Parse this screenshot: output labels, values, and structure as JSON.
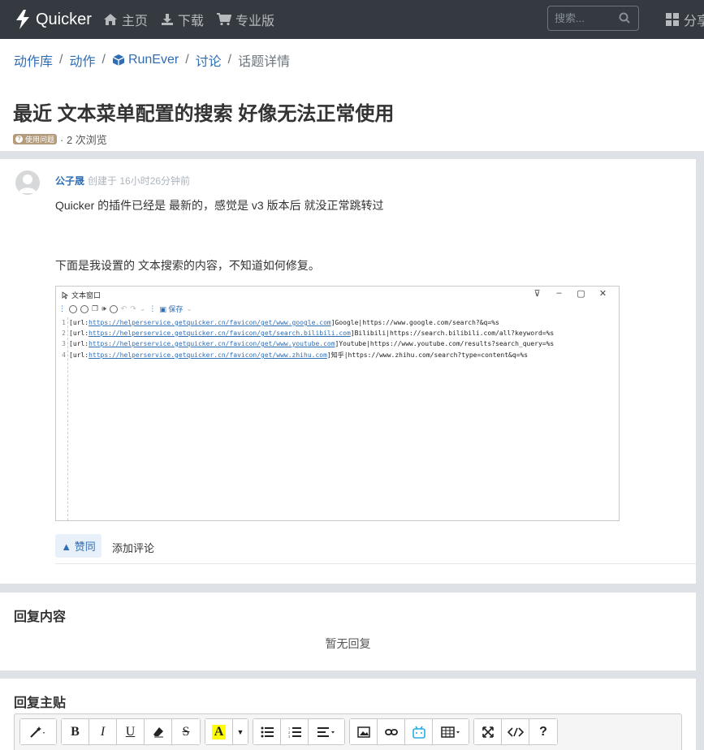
{
  "navbar": {
    "brand": "Quicker",
    "items": [
      {
        "icon": "home-icon",
        "label": "主页"
      },
      {
        "icon": "download-icon",
        "label": "下载"
      },
      {
        "icon": "cart-icon",
        "label": "专业版"
      }
    ],
    "search_placeholder": "搜索...",
    "share_label": "分享"
  },
  "breadcrumb": {
    "items": [
      "动作库",
      "动作",
      "RunEver",
      "讨论",
      "话题详情"
    ]
  },
  "topic": {
    "title": "最近 文本菜单配置的搜索 好像无法正常使用",
    "badge": "使用问题",
    "views": "· 2 次浏览"
  },
  "post": {
    "author": "公子晟",
    "created": "创建于 16小时26分钟前",
    "text1": "Quicker 的插件已经是 最新的，感觉是 v3 版本后 就没正常跳转过",
    "text2": "下面是我设置的 文本搜索的内容，不知道如何修复。",
    "screenshot": {
      "window_title": "文本窗口",
      "save_label": "保存",
      "lines": [
        {
          "num": "1",
          "prefix": "[url:",
          "link": "https://helperservice.getquicker.cn/favicon/get/www.google.com",
          "suffix": "]Google|https://www.google.com/search?&q=%s"
        },
        {
          "num": "2",
          "prefix": "[url:",
          "link": "https://helperservice.getquicker.cn/favicon/get/search.bilibili.com",
          "suffix": "]Bilibili|https://search.bilibili.com/all?keyword=%s"
        },
        {
          "num": "3",
          "prefix": "[url:",
          "link": "https://helperservice.getquicker.cn/favicon/get/www.youtube.com",
          "suffix": "]Youtube|https://www.youtube.com/results?search_query=%s"
        },
        {
          "num": "4",
          "prefix": "[url:",
          "link": "https://helperservice.getquicker.cn/favicon/get/www.zhihu.com",
          "suffix": "]知乎|https://www.zhihu.com/search?type=content&q=%s"
        }
      ]
    },
    "vote_label": "▲ 赞同",
    "comment_label": "添加评论"
  },
  "replies": {
    "title": "回复内容",
    "empty": "暂无回复"
  },
  "reply_form": {
    "title": "回复主贴"
  },
  "colors": {
    "navbar_bg": "#343a40",
    "link": "#2f6eb5",
    "badge": "#b39b7c",
    "page_bg": "#dee2e6"
  }
}
